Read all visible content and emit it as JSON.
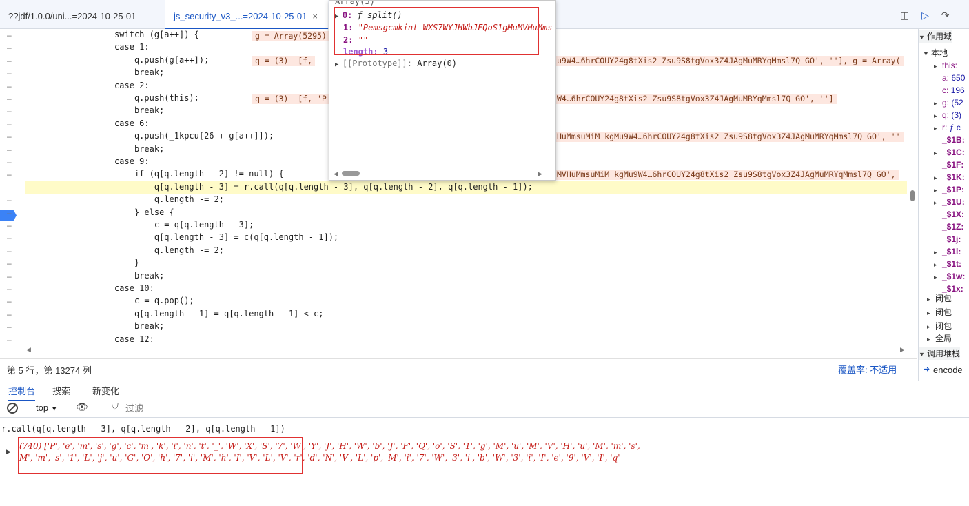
{
  "file_tabs": [
    {
      "label": "??jdf/1.0.0/uni...=2024-10-25-01"
    },
    {
      "label": "js_security_v3_...=2024-10-25-01",
      "close": "×"
    }
  ],
  "toolbar_icons": [
    "panel-toggle-icon",
    "resume-icon",
    "step-over-icon"
  ],
  "gutter_marks": [
    "–",
    "–",
    "–",
    "–",
    "–",
    "–",
    "–",
    "–",
    "–",
    "–",
    "–",
    "–",
    "–",
    "–",
    "–",
    "–",
    "–",
    "–",
    "–",
    "–",
    "–",
    "–",
    "–",
    "–",
    "–"
  ],
  "code_lines": [
    "                  switch (g[a++]) {",
    "                  case 1:",
    "                      q.push(g[a++]);",
    "                      break;",
    "                  case 2:",
    "                      q.push(this);",
    "                      break;",
    "                  case 6:",
    "                      q.push(_1kpcu[26 + g[a++]]);",
    "                      break;",
    "                  case 9:",
    "                      if (q[q.length - 2] != null) {",
    "                          q[q.length - 3] = r.call(q[q.length - 3], q[q.length - 2], q[q.length - 1]);",
    "                          q.length -= 2;",
    "                      } else {",
    "                          c = q[q.length - 3];",
    "                          q[q.length - 3] = c(q[q.length - 1]);",
    "                          q.length -= 2;",
    "                      }",
    "                      break;",
    "                  case 10:",
    "                      c = q.pop();",
    "                      q[q.length - 1] = q[q.length - 1] < c;",
    "                      break;",
    "                  case 12:"
  ],
  "annotations": [
    "g = Array(5295)",
    "q = (3)  [f,",
    "u9W4…6hrCOUY24g8tXis2_Zsu9S8tgVox3Z4JAgMuMRYqMmsl7Q_GO', ''], g = Array(",
    "q = (3)  [f, 'P",
    "W4…6hrCOUY24g8tXis2_Zsu9S8tgVox3Z4JAgMuMRYqMmsl7Q_GO', '']",
    "HuMmsuMiM_kgMu9W4…6hrCOUY24g8tXis2_Zsu9S8tgVox3Z4JAgMuMRYqMmsl7Q_GO', ''",
    "MVHuMmsuMiM_kgMu9W4…6hrCOUY24g8tXis2_Zsu9S8tgVox3Z4JAgMuMRYqMmsl7Q_GO',"
  ],
  "popover": {
    "header": "Array(3)",
    "items": [
      {
        "key": "0:",
        "value": "ƒ split()"
      },
      {
        "key": "1:",
        "value": "\"Pemsgcmkint_WXS7WYJHWbJFQoS1gMuMVHuMms"
      },
      {
        "key": "2:",
        "value": "\"\""
      },
      {
        "key": "length:",
        "value": "3"
      },
      {
        "key": "[[Prototype]]:",
        "value": "Array(0)"
      }
    ]
  },
  "status": {
    "position": "第 5 行，第 13274 列",
    "coverage": "覆盖率:  不适用"
  },
  "scope": {
    "section": "作用域",
    "local": "本地",
    "vars": [
      {
        "name": "this:",
        "val": ""
      },
      {
        "name": "a:",
        "val": "650"
      },
      {
        "name": "c:",
        "val": "196"
      },
      {
        "name": "g:",
        "val": "(52"
      },
      {
        "name": "q:",
        "val": "(3)"
      },
      {
        "name": "r:",
        "val": "ƒ c"
      },
      {
        "name": "_$1B:",
        "val": ""
      },
      {
        "name": "_$1C:",
        "val": ""
      },
      {
        "name": "_$1F:",
        "val": ""
      },
      {
        "name": "_$1K:",
        "val": ""
      },
      {
        "name": "_$1P:",
        "val": ""
      },
      {
        "name": "_$1U:",
        "val": ""
      },
      {
        "name": "_$1X:",
        "val": ""
      },
      {
        "name": "_$1Z:",
        "val": ""
      },
      {
        "name": "_$1j:",
        "val": ""
      },
      {
        "name": "_$1l:",
        "val": ""
      },
      {
        "name": "_$1t:",
        "val": ""
      },
      {
        "name": "_$1w:",
        "val": ""
      },
      {
        "name": "_$1x:",
        "val": ""
      }
    ],
    "closures": [
      "闭包",
      "闭包",
      "闭包"
    ],
    "global": "全局",
    "callstack": "调用堆栈",
    "frame": "encode"
  },
  "console": {
    "tabs": [
      "控制台",
      "搜索",
      "新变化"
    ],
    "context": "top",
    "filter_placeholder": "过滤",
    "command": "r.call(q[q.length - 3], q[q.length - 2], q[q.length - 1])",
    "result_line1": "(740) ['P', 'e', 'm', 's', 'g', 'c', 'm', 'k', 'i', 'n', 't', '_', 'W', 'X', 'S', '7', 'W', 'Y', 'J', 'H', 'W', 'b', 'J', 'F', 'Q', 'o', 'S', '1', 'g', 'M', 'u', 'M', 'V', 'H', 'u', 'M', 'm', 's',",
    "result_line2": "M', 'm', 's', '1', 'L', 'j', 'u', 'G', 'O', 'h', '7', 'i', 'M', 'h', 'I', 'V', 'L', 'V', 'r', 'd', 'N', 'V', 'L', 'p', 'M', 'i', '7', 'W', '3', 'i', 'b', 'W', '3', 'i', 'I', 'e', '9', 'V', 'I', 'q'"
  },
  "colors": {
    "accent": "#1a56c4",
    "highlight": "#fffbc8",
    "annotation_bg": "#fde7e0",
    "string_red": "#c41a16",
    "keyword": "#881280",
    "box_red": "#e03131"
  }
}
